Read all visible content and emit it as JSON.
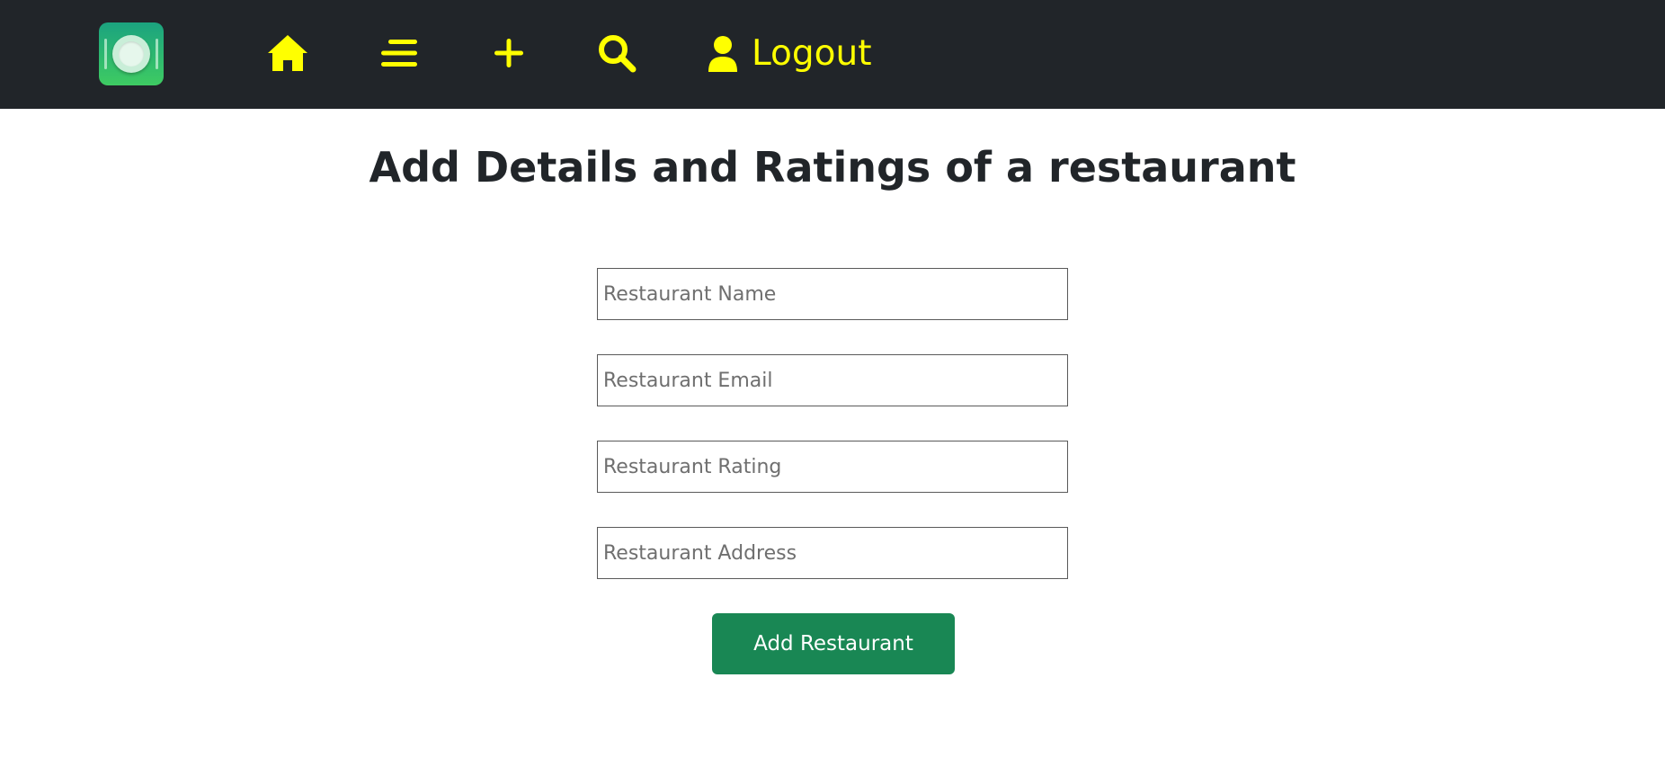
{
  "theme": {
    "navbar_bg": "#212529",
    "accent": "#ffff00",
    "button_bg": "#198754",
    "title_color": "#212529"
  },
  "navbar": {
    "logo_icon": "plate-cutlery-logo",
    "icons": [
      "home-icon",
      "menu-lines-icon",
      "plus-icon",
      "search-icon",
      "user-icon"
    ],
    "logout_label": "Logout"
  },
  "main": {
    "title": "Add Details and Ratings of a restaurant",
    "form": {
      "name_placeholder": "Restaurant Name",
      "name_value": "",
      "email_placeholder": "Restaurant Email",
      "email_value": "",
      "rating_placeholder": "Restaurant Rating",
      "rating_value": "",
      "address_placeholder": "Restaurant Address",
      "address_value": "",
      "submit_label": "Add Restaurant"
    }
  }
}
